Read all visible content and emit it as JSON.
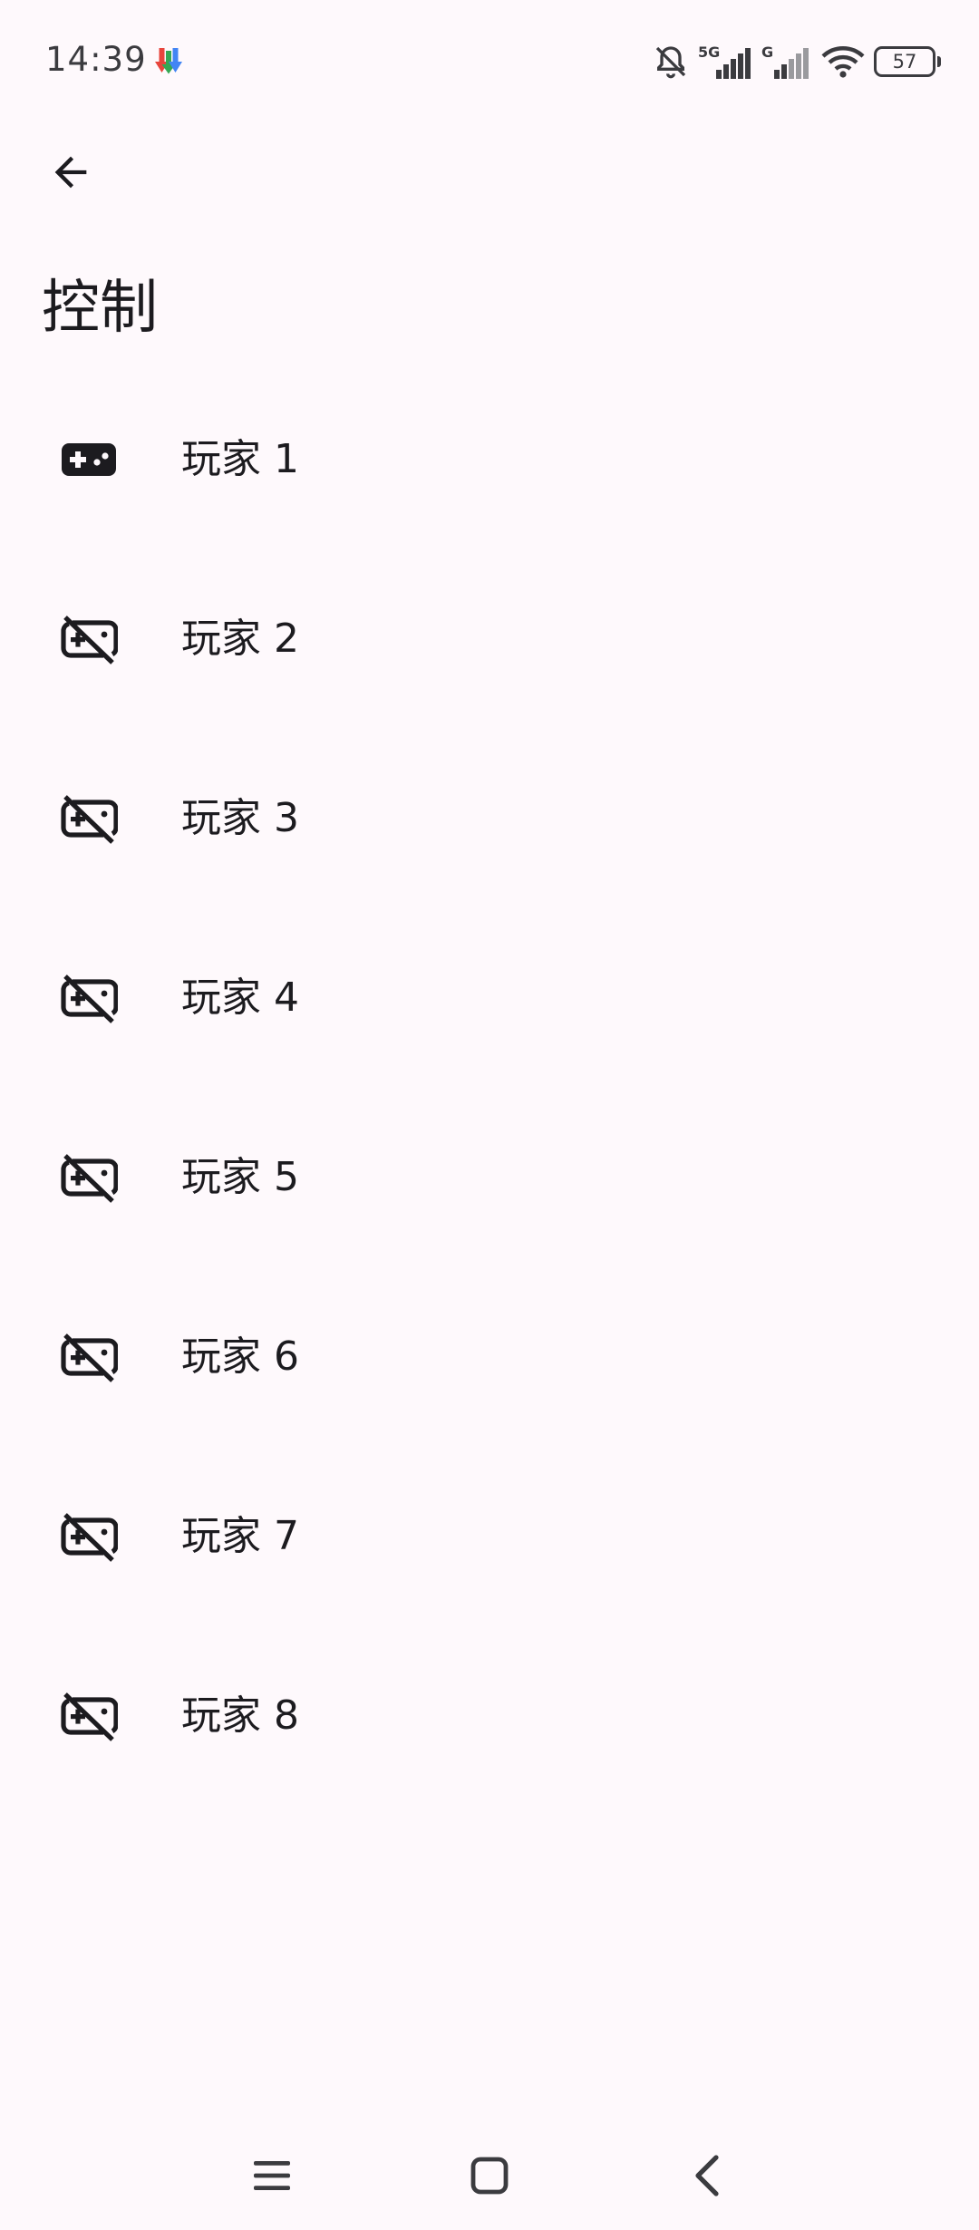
{
  "status_bar": {
    "time": "14:39",
    "battery": "57",
    "icons": [
      "download-icon",
      "bell-off-icon",
      "signal-5g-icon",
      "signal-g-icon",
      "wifi-icon",
      "battery-icon"
    ]
  },
  "header": {
    "back_icon": "arrow-left-icon",
    "title": "控制"
  },
  "players": [
    {
      "label": "玩家 1",
      "icon": "gamepad-icon",
      "connected": true
    },
    {
      "label": "玩家 2",
      "icon": "gamepad-off-icon",
      "connected": false
    },
    {
      "label": "玩家 3",
      "icon": "gamepad-off-icon",
      "connected": false
    },
    {
      "label": "玩家 4",
      "icon": "gamepad-off-icon",
      "connected": false
    },
    {
      "label": "玩家 5",
      "icon": "gamepad-off-icon",
      "connected": false
    },
    {
      "label": "玩家 6",
      "icon": "gamepad-off-icon",
      "connected": false
    },
    {
      "label": "玩家 7",
      "icon": "gamepad-off-icon",
      "connected": false
    },
    {
      "label": "玩家 8",
      "icon": "gamepad-off-icon",
      "connected": false
    }
  ],
  "nav_bar": {
    "icons": [
      "menu-icon",
      "home-icon",
      "back-icon"
    ]
  },
  "colors": {
    "background": "#FEF9FC",
    "text": "#1C1B1F",
    "status_text": "#3B3B3F"
  }
}
